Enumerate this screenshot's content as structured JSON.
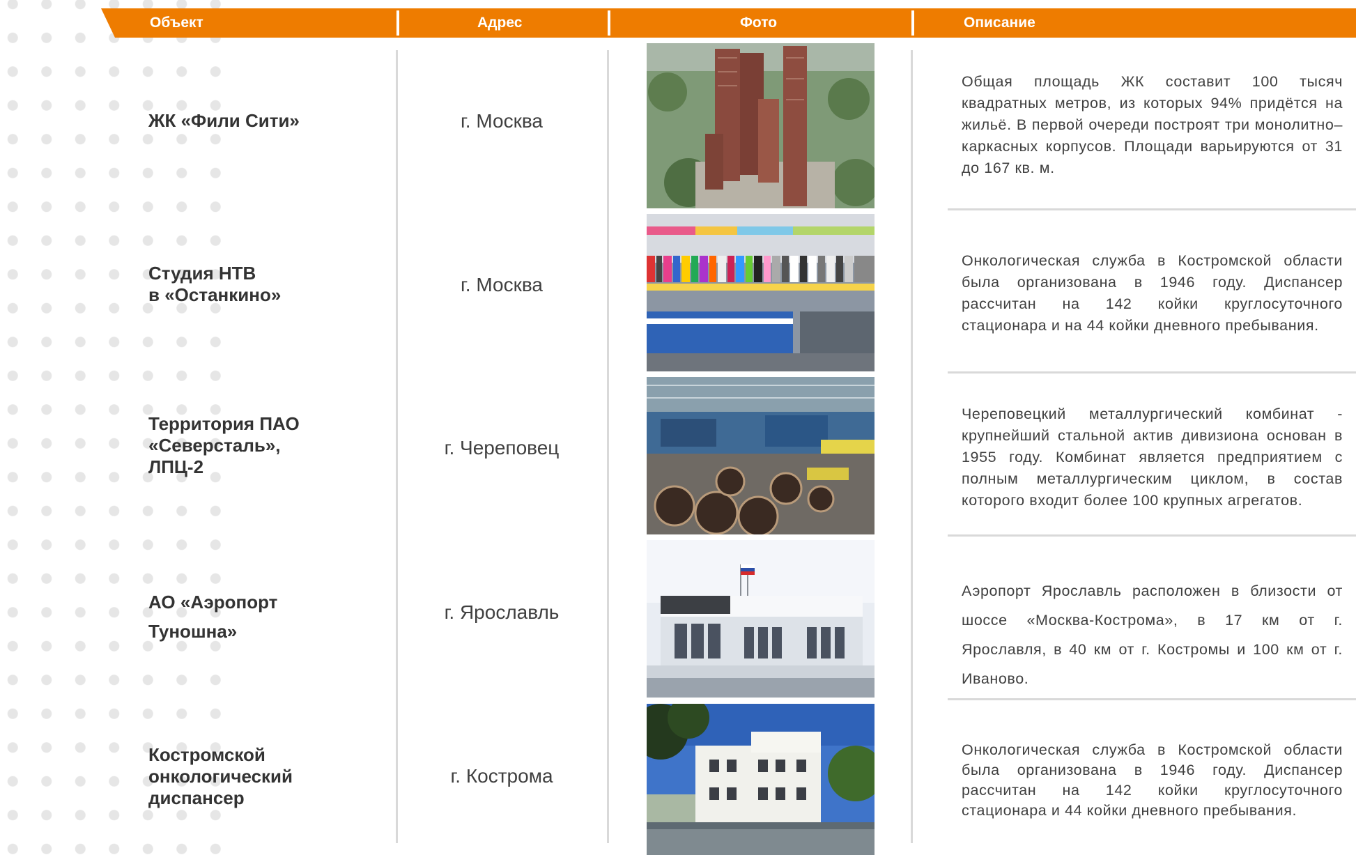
{
  "header": {
    "col_object": "Объект",
    "col_address": "Адрес",
    "col_photo": "Фото",
    "col_description": "Описание"
  },
  "rows": [
    {
      "object": "ЖК «Фили Сити»",
      "address": "г. Москва",
      "photo": "residential-towers-photo",
      "description": "Общая площадь ЖК составит 100 тысяч квадратных метров, из которых 94% придётся на жильё. В первой очереди построят три монолитно–каркасных корпусов. Площади варьируются от 31 до 167 кв. м."
    },
    {
      "object": "Студия НТВ\nв «Останкино»",
      "address": "г. Москва",
      "photo": "ntv-studio-photo",
      "description": "Онкологическая служба в Костромской области была организована в 1946 году. Диспансер рассчитан на 142 койки круглосуточного стационара и на 44 койки дневного пребывания."
    },
    {
      "object": "Территория ПАО\n«Северсталь»,\nЛПЦ-2",
      "address": "г. Череповец",
      "photo": "steel-plant-workshop-photo",
      "description": "Череповецкий металлургический комбинат - крупнейший стальной актив дивизиона основан в 1955 году. Комбинат является предприятием с полным металлургическим циклом, в состав которого входит более 100 крупных агрегатов."
    },
    {
      "object": "АО «Аэропорт\nТуношна»",
      "address": "г. Ярославль",
      "photo": "airport-terminal-photo",
      "description": "Аэропорт Ярославль расположен в близости от шоссе «Москва-Кострома», в 17 км от г. Ярославля, в 40 км от г. Костромы и 100 км от г. Иваново."
    },
    {
      "object": "Костромской\nонкологический\nдиспансер",
      "address": "г. Кострома",
      "photo": "oncology-clinic-photo",
      "description": "Онкологическая служба в Костромской области была организована в 1946 году. Диспансер рассчитан на 142 койки круглосуточного стационара и 44 койки дневного пребывания."
    }
  ],
  "colors": {
    "accent": "#ee7c00",
    "separator": "#d9d9d9",
    "dots": "#e6e6e6",
    "text": "#333333"
  }
}
